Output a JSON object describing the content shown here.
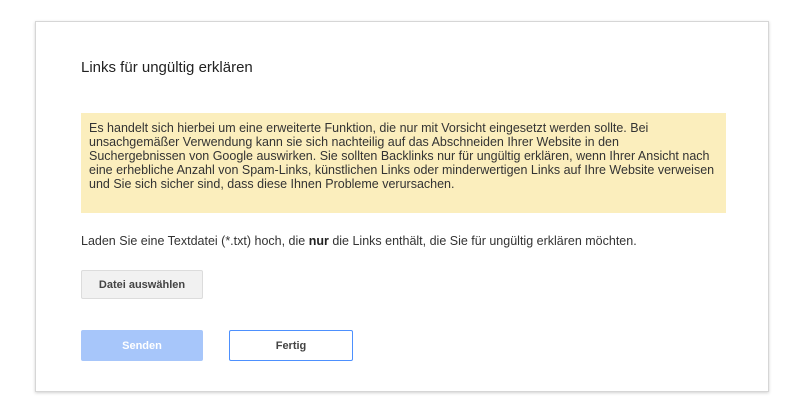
{
  "dialog": {
    "title": "Links für ungültig erklären",
    "warning_text": "Es handelt sich hierbei um eine erweiterte Funktion, die nur mit Vorsicht eingesetzt werden sollte. Bei unsachgemäßer Verwendung kann sie sich nachteilig auf das Abschneiden Ihrer Website in den Suchergebnissen von Google auswirken. Sie sollten Backlinks nur für ungültig erklären, wenn Ihrer Ansicht nach eine erhebliche Anzahl von Spam-Links, künstlichen Links oder minderwertigen Links auf Ihre Website verweisen und Sie sich sicher sind, dass diese Ihnen Probleme verursachen.",
    "instruction_before": "Laden Sie eine Textdatei (*.txt) hoch, die ",
    "instruction_bold": "nur",
    "instruction_after": " die Links enthält, die Sie für ungültig erklären möchten.",
    "file_button_label": "Datei auswählen",
    "send_button_label": "Senden",
    "done_button_label": "Fertig"
  },
  "colors": {
    "warning_background": "#fbeebd",
    "send_button_disabled": "#a7c6fa",
    "focus_border": "#4d90fe"
  }
}
